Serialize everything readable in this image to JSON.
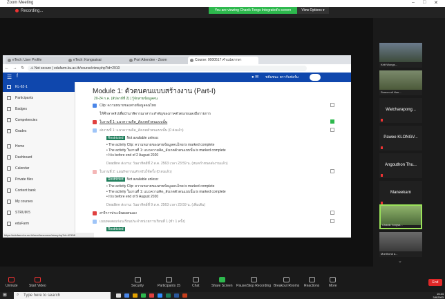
{
  "zoom": {
    "title": "Zoom Meeting",
    "recording_label": "Recording...",
    "banner_text": "You are viewing Chanik Tongs Integrated's screen",
    "view_options": "View Options ▾"
  },
  "browser": {
    "tabs": [
      {
        "label": "eTech: User Profile"
      },
      {
        "label": "eTech: Kongsaisai"
      },
      {
        "label": "Port Attendee - Zoom"
      },
      {
        "label": "Course: 0000517 คำแปลภาษา"
      }
    ],
    "url": "edufarm.ku.ac.th/course/view.php?id=2910",
    "not_secure": "Not secure"
  },
  "moodle": {
    "user_name": "ชยันชนะ ตรากับฟอร์ม",
    "sidebar": [
      {
        "label": "KL-62-1",
        "active": true
      },
      {
        "label": "Participants"
      },
      {
        "label": "Badges"
      },
      {
        "label": "Competencies"
      },
      {
        "label": "Grades"
      },
      {
        "label": "Home"
      },
      {
        "label": "Dashboard"
      },
      {
        "label": "Calendar"
      },
      {
        "label": "Private files"
      },
      {
        "label": "Content bank"
      },
      {
        "label": "My courses"
      },
      {
        "label": "STRUM 5"
      },
      {
        "label": "eduFarm"
      }
    ],
    "module_title": "Module 1: ตัวตนคนแบบสร้างงาน (Part-I)",
    "module_subtitle": "20-24 ก.ค. (สัปดาห์ที่ 2) | รู้จักสายข้อมูลคน",
    "rows": [
      {
        "text": "Clip: ความหมายของสายข้อมูลคนไทย",
        "color": "#4a86e8"
      },
      {
        "text": "ให้ศึกษาคลิปเพื่อนำมาพิจารณาสาระสำคัญของภาคตัวตนก่อนลงมือรายการ",
        "color": "#ffffff"
      },
      {
        "text": "ใบงานที่ 1: แนวความคิด_สังเกตตัวตนแบบนั้น",
        "color": "#e04040"
      },
      {
        "text": "ส่งงานที่ 1: แนวความคิด_สังเกตตัวตนแบบนั้น (0 ส่งแล้ว)",
        "color": "#9fc5f8"
      }
    ],
    "restricted_label": "Restricted",
    "not_available": "Not available unless:",
    "bullets_1": [
      "• The activity Clip: ความหมายของสายข้อมูลคนไทย is marked complete",
      "• The activity ใบงานที่ 1: แนวความคิด_สังเกตตัวตนแบบนั้น is marked complete",
      "• It is before end of 2 August 2020"
    ],
    "row_2": "Deadline ส่งงาน: วันอาทิตย์ที่ 2 ส.ค. 2563 เวลา 23:59 น. (หมดกำหนดส่งงานแล้ว)",
    "row_3": "ใบงานที่ 2: แผนกิจกรรมสำหรับใช้ครั้ง (0 ส่งแล้ว)",
    "bullets_2": [
      "• The activity Clip: ความหมายของสายข้อมูลคนไทย is marked complete",
      "• The activity ใบงานที่ 1: แนวความคิด_สังเกตตัวตนแบบนั้น is marked complete",
      "• It is before end of 9 August 2020"
    ],
    "row_4": "Deadline ส่งงาน: วันอาทิตย์ที่ 9 ส.ค. 2563 เวลา 23:59 น. (เพิ่มเติม)",
    "row_5": "สารีการประเมินผลตนเอง",
    "row_6": "แบบทดสอบก่อนเรียนประจำหน่วยการเรียนที่ 1 (ทำ 1 ครั้ง)",
    "status_url": "https://edufarm.ku.ac.th/mod/resource/view.php?id=42158"
  },
  "participants": [
    {
      "name": "Kritt Wongs...",
      "photo": true
    },
    {
      "name": "Sumon oil Hun...",
      "photo": true
    },
    {
      "name": "Watcharapong..."
    },
    {
      "name": "Pawee KLONGV..."
    },
    {
      "name": "Angouthon Thu..."
    },
    {
      "name": "Maneekarn"
    },
    {
      "name": "Chanik Tongsa...",
      "photo": true,
      "highlight": true
    },
    {
      "name": "Monthond a...",
      "photo": true
    }
  ],
  "toolbar": {
    "items": [
      "Unmute",
      "Start Video",
      "Security",
      "Participants",
      "Chat",
      "Share Screen",
      "Pause/Stop Recording",
      "Breakout Rooms",
      "Reactions",
      "More"
    ],
    "participants_count": "15",
    "end": "End"
  },
  "taskbar": {
    "search_placeholder": "Type here to search",
    "time": "10:44",
    "date": "3/8/2563"
  }
}
